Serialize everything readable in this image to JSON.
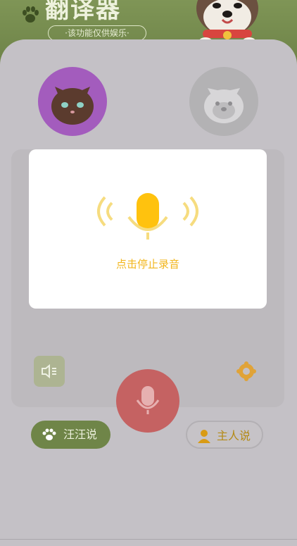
{
  "header": {
    "title": "翻译器",
    "subtitle": "·该功能仅供娱乐·"
  },
  "popup": {
    "text": "点击停止录音"
  },
  "buttons": {
    "dog_speak": "汪汪说",
    "owner_speak": "主人说"
  },
  "colors": {
    "header_green": "#6f8548",
    "card_gray": "#c4c1c6",
    "accent_yellow": "#f2b61c",
    "mic_red": "#c56262",
    "cat_ring": "#a35cbd"
  },
  "icons": [
    "paw-icon",
    "dog-mascot",
    "cat-avatar",
    "dog-avatar",
    "microphone-icon",
    "speaker-icon",
    "gear-icon",
    "person-icon"
  ]
}
